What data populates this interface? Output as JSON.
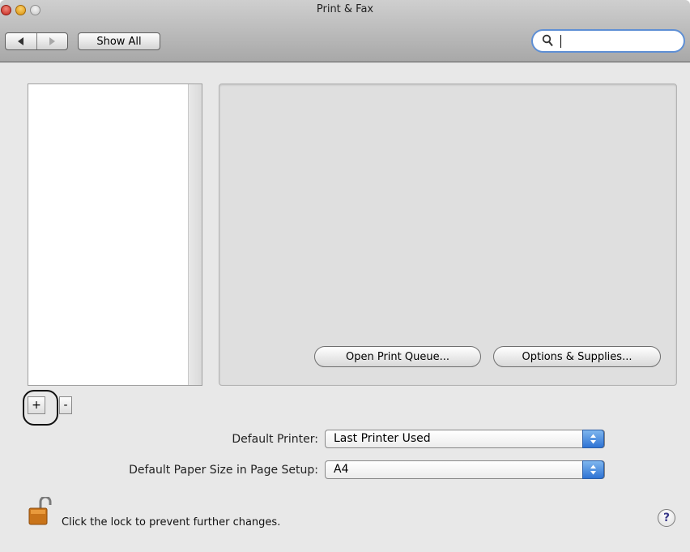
{
  "window": {
    "title": "Print & Fax"
  },
  "toolbar": {
    "back_icon": "back-arrow-icon",
    "forward_icon": "forward-arrow-icon",
    "show_all_label": "Show All",
    "search": {
      "value": "",
      "placeholder": ""
    }
  },
  "printer_list": {
    "items": [],
    "add_label": "+",
    "remove_label": "-"
  },
  "detail": {
    "open_queue_label": "Open Print Queue...",
    "options_supplies_label": "Options & Supplies..."
  },
  "settings": {
    "default_printer_label": "Default Printer:",
    "default_printer_value": "Last Printer Used",
    "default_paper_label": "Default Paper Size in Page Setup:",
    "default_paper_value": "A4"
  },
  "footer": {
    "lock_text": "Click the lock to prevent further changes.",
    "help_label": "?"
  },
  "colors": {
    "accent": "#2f73d4",
    "search_focus": "#5e8fd5"
  }
}
